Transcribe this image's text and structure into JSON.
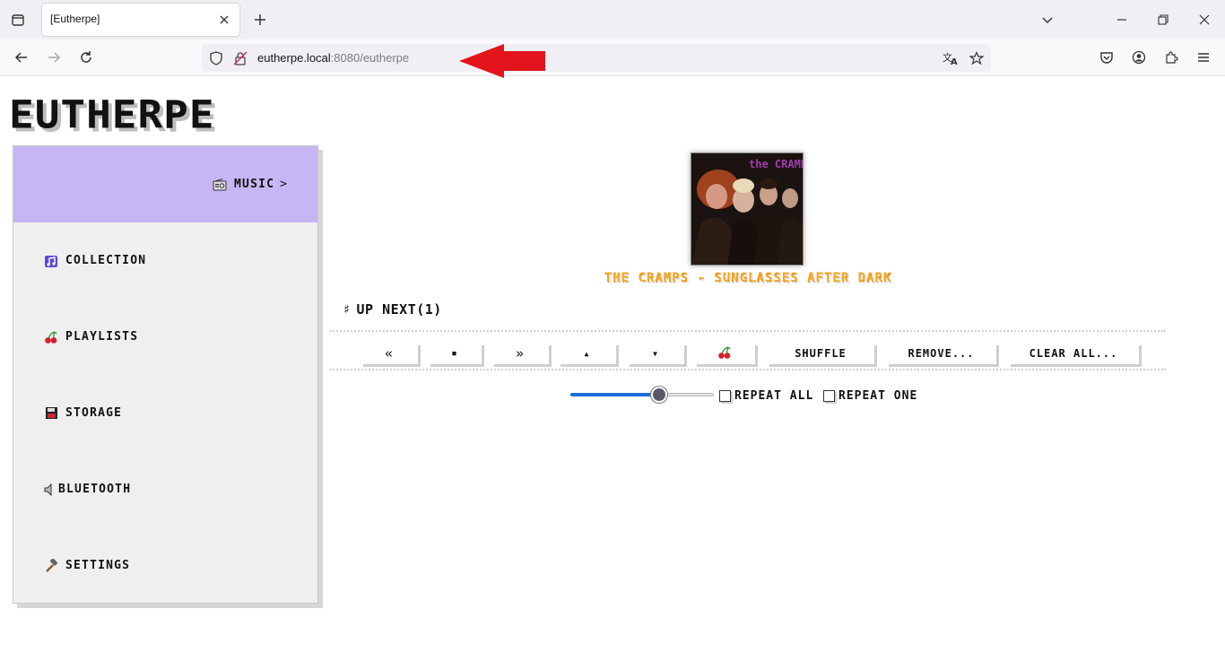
{
  "browser": {
    "tab_title": "[Eutherpe]",
    "url_host": "eutherpe.local",
    "url_rest": ":8080/eutherpe"
  },
  "app": {
    "logo_text": "EUTHERPE"
  },
  "sidebar": {
    "items": [
      {
        "label": "MUSIC",
        "icon": "radio-icon",
        "active": true,
        "chevron": ">"
      },
      {
        "label": "COLLECTION",
        "icon": "music-notes-icon",
        "active": false
      },
      {
        "label": "PLAYLISTS",
        "icon": "cherries-icon",
        "active": false
      },
      {
        "label": "STORAGE",
        "icon": "floppy-disk-icon",
        "active": false
      },
      {
        "label": "BLUETOOTH",
        "icon": "speaker-icon",
        "active": false
      },
      {
        "label": "SETTINGS",
        "icon": "hammer-icon",
        "active": false
      }
    ]
  },
  "player": {
    "now_playing": "THE CRAMPS - SUNGLASSES AFTER DARK",
    "album_art_text": "the CRAMPS",
    "upnext_hash": "♯",
    "upnext_label": "UP NEXT(1)",
    "volume_percent": 62,
    "controls": {
      "prev": "«",
      "stop": "■",
      "next": "»",
      "up": "▲",
      "down": "▼",
      "cherry": "🍒",
      "shuffle": "SHUFFLE",
      "remove": "REMOVE...",
      "clear_all": "CLEAR ALL..."
    },
    "repeat_all_label": "REPEAT ALL",
    "repeat_one_label": "REPEAT ONE",
    "repeat_all_checked": false,
    "repeat_one_checked": false
  },
  "colors": {
    "sidebar_active": "#c6b7f4",
    "now_playing": "#f5a623",
    "annotation_arrow": "#e3141c",
    "slider_fill": "#1e6fd9"
  }
}
